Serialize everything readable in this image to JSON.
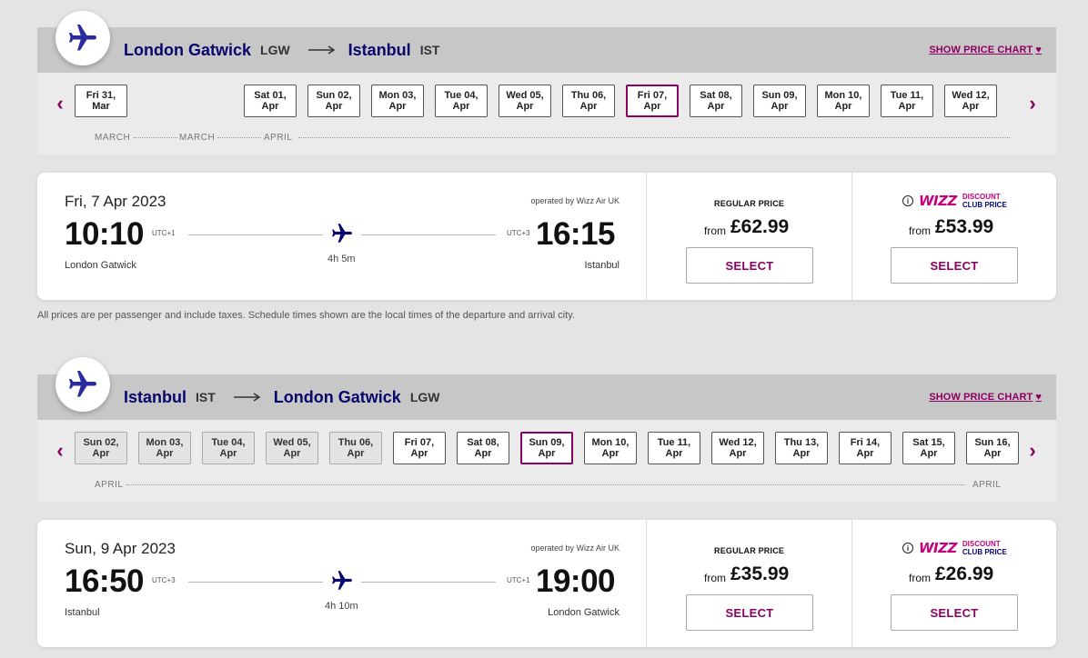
{
  "colors": {
    "brand_navy": "#06066d",
    "brand_magenta": "#8c0063",
    "wizz_pink": "#c6007e"
  },
  "outbound": {
    "header": {
      "origin_city": "London Gatwick",
      "origin_code": "LGW",
      "dest_city": "Istanbul",
      "dest_code": "IST",
      "show_price_chart": "SHOW PRICE CHART"
    },
    "days": [
      {
        "l1": "Fri 31,",
        "l2": "Mar"
      },
      {
        "l1": "Sat 01,",
        "l2": "Apr"
      },
      {
        "l1": "Sun 02,",
        "l2": "Apr"
      },
      {
        "l1": "Mon 03,",
        "l2": "Apr"
      },
      {
        "l1": "Tue 04,",
        "l2": "Apr"
      },
      {
        "l1": "Wed 05,",
        "l2": "Apr"
      },
      {
        "l1": "Thu 06,",
        "l2": "Apr"
      },
      {
        "l1": "Fri 07,",
        "l2": "Apr"
      },
      {
        "l1": "Sat 08,",
        "l2": "Apr"
      },
      {
        "l1": "Sun 09,",
        "l2": "Apr"
      },
      {
        "l1": "Mon 10,",
        "l2": "Apr"
      },
      {
        "l1": "Tue 11,",
        "l2": "Apr"
      },
      {
        "l1": "Wed 12,",
        "l2": "Apr"
      }
    ],
    "months": [
      "MARCH",
      "MARCH",
      "APRIL"
    ],
    "flight": {
      "date": "Fri, 7 Apr 2023",
      "operated_by": "operated by Wizz Air UK",
      "dep_time": "10:10",
      "dep_utc": "UTC+1",
      "dep_city": "London Gatwick",
      "arr_time": "16:15",
      "arr_utc": "UTC+3",
      "arr_city": "Istanbul",
      "duration": "4h 5m",
      "regular_label": "REGULAR PRICE",
      "regular_from": "from",
      "regular_price": "£62.99",
      "club_from": "from",
      "club_price": "£53.99",
      "select": "SELECT"
    }
  },
  "footnote": "All prices are per passenger and include taxes. Schedule times shown are the local times of the departure and arrival city.",
  "inbound": {
    "header": {
      "origin_city": "Istanbul",
      "origin_code": "IST",
      "dest_city": "London Gatwick",
      "dest_code": "LGW",
      "show_price_chart": "SHOW PRICE CHART"
    },
    "days": [
      {
        "l1": "Sun 02,",
        "l2": "Apr"
      },
      {
        "l1": "Mon 03,",
        "l2": "Apr"
      },
      {
        "l1": "Tue 04,",
        "l2": "Apr"
      },
      {
        "l1": "Wed 05,",
        "l2": "Apr"
      },
      {
        "l1": "Thu 06,",
        "l2": "Apr"
      },
      {
        "l1": "Fri 07,",
        "l2": "Apr"
      },
      {
        "l1": "Sat 08,",
        "l2": "Apr"
      },
      {
        "l1": "Sun 09,",
        "l2": "Apr"
      },
      {
        "l1": "Mon 10,",
        "l2": "Apr"
      },
      {
        "l1": "Tue 11,",
        "l2": "Apr"
      },
      {
        "l1": "Wed 12,",
        "l2": "Apr"
      },
      {
        "l1": "Thu 13,",
        "l2": "Apr"
      },
      {
        "l1": "Fri 14,",
        "l2": "Apr"
      },
      {
        "l1": "Sat 15,",
        "l2": "Apr"
      },
      {
        "l1": "Sun 16,",
        "l2": "Apr"
      }
    ],
    "months": [
      "APRIL",
      "APRIL"
    ],
    "flight": {
      "date": "Sun, 9 Apr 2023",
      "operated_by": "operated by Wizz Air UK",
      "dep_time": "16:50",
      "dep_utc": "UTC+3",
      "dep_city": "Istanbul",
      "arr_time": "19:00",
      "arr_utc": "UTC+1",
      "arr_city": "London Gatwick",
      "duration": "4h 10m",
      "regular_label": "REGULAR PRICE",
      "regular_from": "from",
      "regular_price": "£35.99",
      "club_from": "from",
      "club_price": "£26.99",
      "select": "SELECT"
    }
  },
  "club": {
    "logo": "WIZZ",
    "line1": "DISCOUNT",
    "line2": "CLUB PRICE"
  }
}
